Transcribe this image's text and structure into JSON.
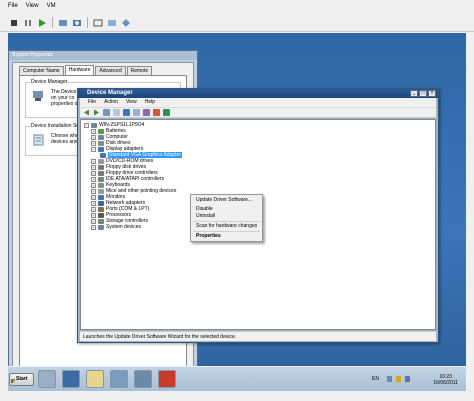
{
  "host": {
    "menu": [
      "File",
      "View",
      "VM"
    ]
  },
  "system_properties": {
    "title": "System Properties",
    "tabs": [
      "Computer Name",
      "Hardware",
      "Advanced",
      "Remote"
    ],
    "device_manager_group": {
      "legend": "Device Manager",
      "text": [
        "The Device",
        "on your co",
        "properties of"
      ]
    },
    "installation_group": {
      "legend": "Device Installation Setti",
      "text": [
        "Choose whet",
        "devices and"
      ]
    }
  },
  "device_manager": {
    "title": "Device Manager",
    "menu": [
      "File",
      "Action",
      "View",
      "Help"
    ],
    "tree": {
      "root": "WIN-2SPS1L1P9O4",
      "items": [
        "Batteries",
        "Computer",
        "Disk drives",
        "Display adapters",
        "Standard VGA Graphics Adapter",
        "DVD/CD-ROM drives",
        "Floppy disk drives",
        "Floppy drive controllers",
        "IDE ATA/ATAPI controllers",
        "Keyboards",
        "Mice and other pointing devices",
        "Monitors",
        "Network adapters",
        "Ports (COM & LPT)",
        "Processors",
        "Storage controllers",
        "System devices"
      ]
    },
    "status": "Launches the Update Driver Software Wizard for the selected device."
  },
  "context_menu": {
    "items": [
      "Update Driver Software...",
      "Disable",
      "Uninstall",
      "Scan for hardware changes",
      "Properties"
    ]
  },
  "taskbar": {
    "start": "Start",
    "lang": "EN",
    "time": "16:23",
    "date": "16/06/2011"
  },
  "colors": {
    "desktop": "#3b76b8",
    "titlebar": "#1c4680",
    "selection": "#3399ff"
  }
}
